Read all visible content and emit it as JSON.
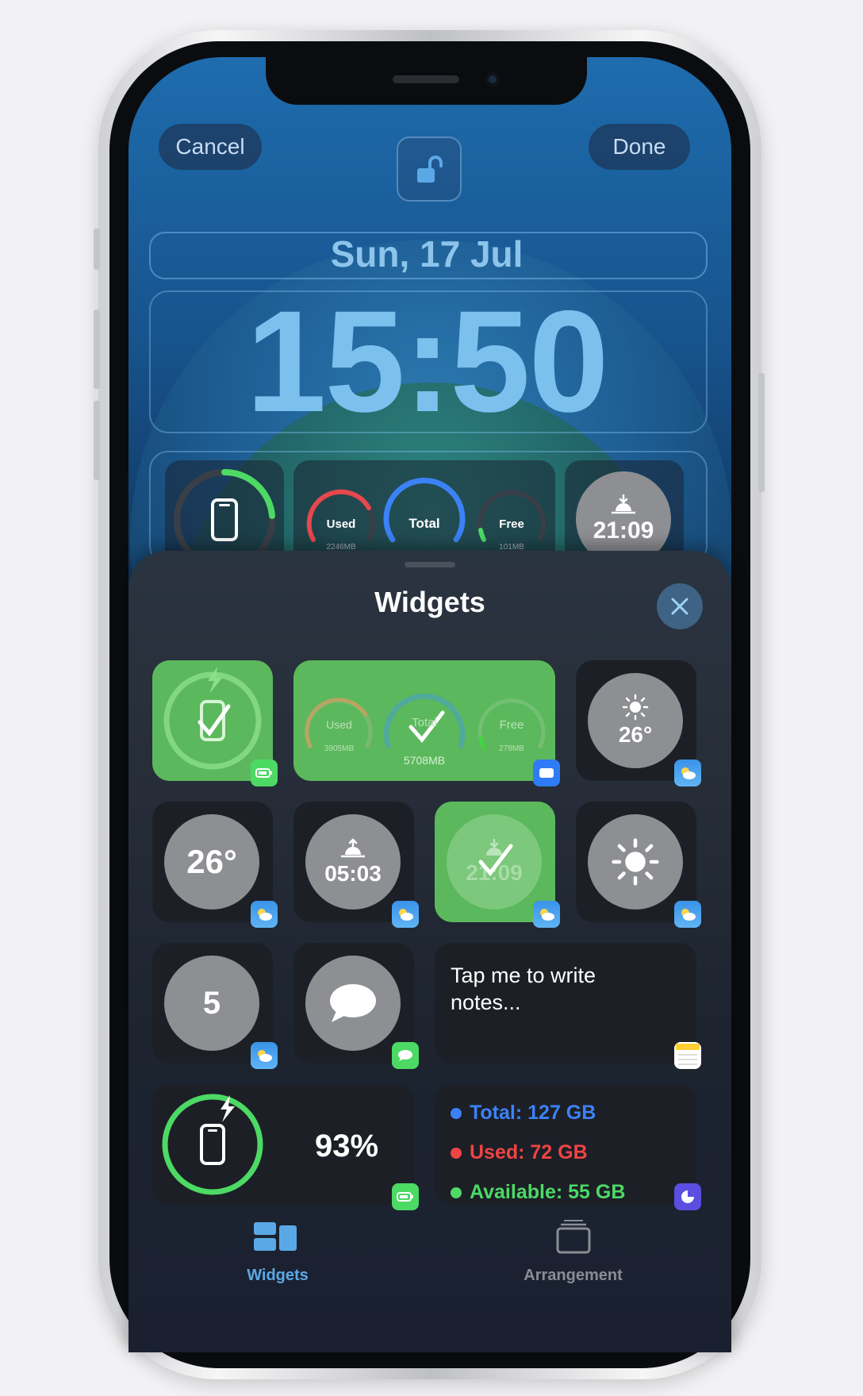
{
  "lockscreen": {
    "cancel_label": "Cancel",
    "done_label": "Done",
    "date": "Sun, 17 Jul",
    "time": "15:50",
    "widgets": {
      "ram_used_label": "Used",
      "ram_used_value": "2246MB",
      "ram_total_label": "Total",
      "ram_free_label": "Free",
      "ram_free_value": "101MB",
      "sunset_time": "21:09"
    }
  },
  "sheet": {
    "title": "Widgets",
    "gallery": {
      "ram_used_label": "Used",
      "ram_used_value": "3905MB",
      "ram_total_label": "Total",
      "ram_total_value": "5708MB",
      "ram_free_label": "Free",
      "ram_free_value": "278MB",
      "weather_temp_small": "26°",
      "weather_temp": "26°",
      "sunrise_time": "05:03",
      "sunset_time": "21:09",
      "uv_index": "5",
      "notes_text": "Tap me to write notes...",
      "battery_percent": "93%",
      "storage": {
        "total": "Total: 127 GB",
        "used": "Used: 72 GB",
        "available": "Available: 55 GB"
      }
    },
    "tabs": [
      {
        "label": "Widgets",
        "active": true
      },
      {
        "label": "Arrangement",
        "active": false
      }
    ]
  },
  "colors": {
    "accent_blue": "#5aa9e6",
    "green": "#5cb85c",
    "storage_total": "#3b82f6",
    "storage_used": "#ef4444",
    "storage_available": "#4cd964"
  },
  "icons": [
    "lock-open-icon",
    "close-icon",
    "phone-icon",
    "sunset-icon",
    "sun-icon",
    "message-icon",
    "bolt-icon",
    "weather-badge-icon",
    "notes-badge-icon",
    "storage-badge-icon",
    "widgets-tab-icon",
    "arrangement-tab-icon"
  ]
}
